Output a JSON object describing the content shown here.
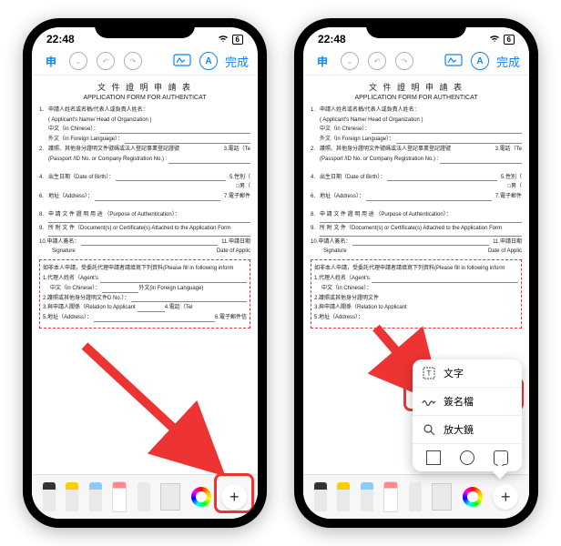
{
  "status": {
    "time": "22:48",
    "battery": "6"
  },
  "toolbar": {
    "back_label": "申",
    "done_label": "完成",
    "auto_label": "A"
  },
  "document": {
    "title_cn": "文 件 證 明 申 請 表",
    "title_en": "APPLICATION FORM FOR AUTHENTICAT",
    "field1_label": "申請人姓名或名稱/代表人或負責人姓名：",
    "field1_label_en": "( Applicant's Name/ Head of Organization )",
    "chinese_label": "中文（in Chinese）：",
    "foreign_label": "外文（in Foreign Language）：",
    "field2_label": "護照、其他身分證明文件號碼或法人登記事業登記證號",
    "field2_label_en": "(Passport /ID No. or Company Registration No.) :",
    "field3_label": "電話（Te",
    "field4_label": "出生日期（Date of Birth）：",
    "field5_label": "性別（",
    "field5_opt": "□男（",
    "field6_label": "地址（Address）：",
    "field7_label": "電子郵件",
    "field8_label": "申 請 文 件 證 明 用 途 （Purpose of Authentication）：",
    "field9_label": "所 附 文 件（Document(s) or Certificate(s) Attached to the Application Form",
    "field10_label": "申請人簽名：",
    "field10_label_en": "Signature",
    "field11_label": "申請日期",
    "field11_label_en": "Date of Applic",
    "redbox_header": "如非本人申請，受委託代理申請者請填寫下列資料(Please fill in following inform",
    "rb1": "代理人姓名（Agent's",
    "rb1_cn": "中文（in Chinese）：",
    "rb1_fl": "外文(in Foreign Language)",
    "rb2": "護照或其他身分證明文件",
    "rb2_fl": "D No.）：",
    "rb3": "與申請人關係（Relation to Applicant",
    "rb4_tel": "電話（Tel",
    "rb5": "地址（Address）：",
    "rb6": "電子郵件信"
  },
  "popup": {
    "item1": "文字",
    "item2": "簽名檔",
    "item3": "放大鏡"
  }
}
